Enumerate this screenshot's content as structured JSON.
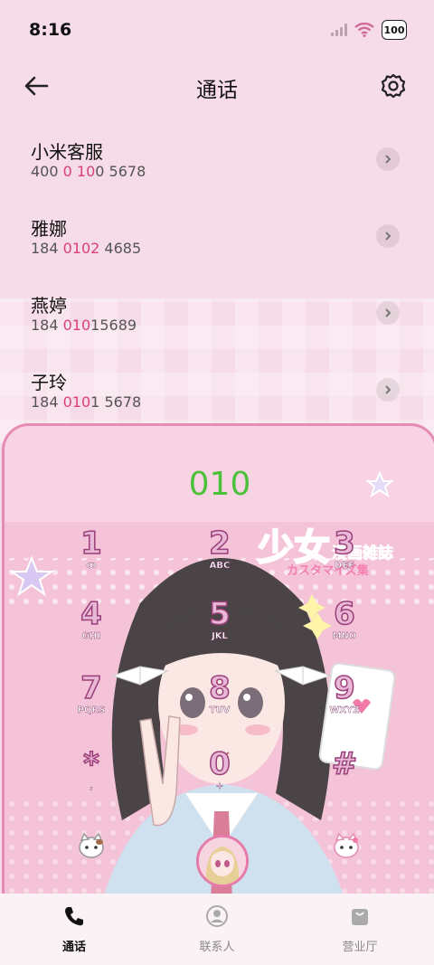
{
  "status": {
    "time": "8:16",
    "battery": "100"
  },
  "header": {
    "title": "通话"
  },
  "contacts": [
    {
      "name": "小米客服",
      "prefix": "400 ",
      "highlight": "0",
      "mid": " ",
      "highlight2": "10",
      "suffix": "0 5678"
    },
    {
      "name": "雅娜",
      "prefix": "184 ",
      "highlight": "0102",
      "mid": "",
      "highlight2": "",
      "suffix": " 4685"
    },
    {
      "name": "燕婷",
      "prefix": "184 ",
      "highlight": "010",
      "mid": "",
      "highlight2": "",
      "suffix": "15689"
    },
    {
      "name": "子玲",
      "prefix": "184 ",
      "highlight": "010",
      "mid": "",
      "highlight2": "",
      "suffix": "1 5678"
    }
  ],
  "dialer": {
    "input": "010",
    "keys": [
      {
        "digit": "1",
        "letters": "ꝏ"
      },
      {
        "digit": "2",
        "letters": "ABC"
      },
      {
        "digit": "3",
        "letters": "DEF"
      },
      {
        "digit": "4",
        "letters": "GHI"
      },
      {
        "digit": "5",
        "letters": "JKL"
      },
      {
        "digit": "6",
        "letters": "MNO"
      },
      {
        "digit": "7",
        "letters": "PQRS"
      },
      {
        "digit": "8",
        "letters": "TUV"
      },
      {
        "digit": "9",
        "letters": "WXYZ"
      },
      {
        "digit": "*",
        "letters": ","
      },
      {
        "digit": "0",
        "letters": "+"
      },
      {
        "digit": "#",
        "letters": ""
      }
    ],
    "artwork_text": {
      "title": "少女",
      "subtitle": "漫画雑誌",
      "sub2": "カスタマイズ集"
    }
  },
  "tabs": [
    {
      "label": "通话",
      "active": true
    },
    {
      "label": "联系人",
      "active": false
    },
    {
      "label": "营业厅",
      "active": false
    }
  ],
  "colors": {
    "accent": "#d9407a",
    "dial_green": "#4cc23c",
    "frame": "#e58cb5"
  }
}
